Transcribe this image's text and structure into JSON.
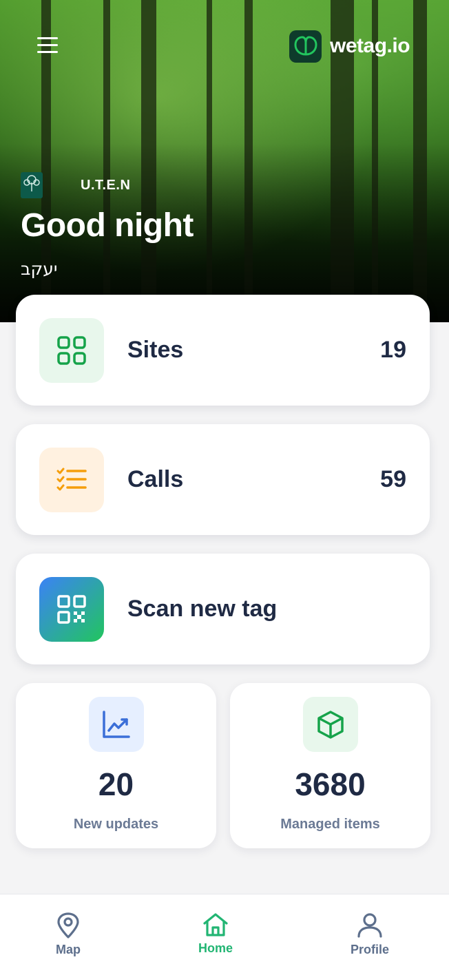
{
  "header": {
    "brand_name": "wetag.io",
    "org_name": "U.T.E.N",
    "greeting": "Good night",
    "username": "יעקב"
  },
  "cards": {
    "sites": {
      "label": "Sites",
      "count": "19",
      "icon": "grid-icon",
      "color": "#16a34a",
      "bg": "#e8f7ec"
    },
    "calls": {
      "label": "Calls",
      "count": "59",
      "icon": "checklist-icon",
      "color": "#f59e0b",
      "bg": "#fff1e0"
    },
    "scan": {
      "label": "Scan new tag",
      "icon": "qr-code-icon"
    }
  },
  "stats": {
    "updates": {
      "value": "20",
      "label": "New updates",
      "icon": "trend-chart-icon"
    },
    "items": {
      "value": "3680",
      "label": "Managed items",
      "icon": "box-icon"
    }
  },
  "nav": {
    "map": {
      "label": "Map",
      "icon": "map-pin-icon"
    },
    "home": {
      "label": "Home",
      "icon": "home-icon",
      "active": true
    },
    "profile": {
      "label": "Profile",
      "icon": "user-icon"
    }
  },
  "colors": {
    "accent": "#22b573",
    "text_dark": "#1f2a44",
    "muted": "#6b7a95",
    "nav_inactive": "#5d6f8c"
  }
}
